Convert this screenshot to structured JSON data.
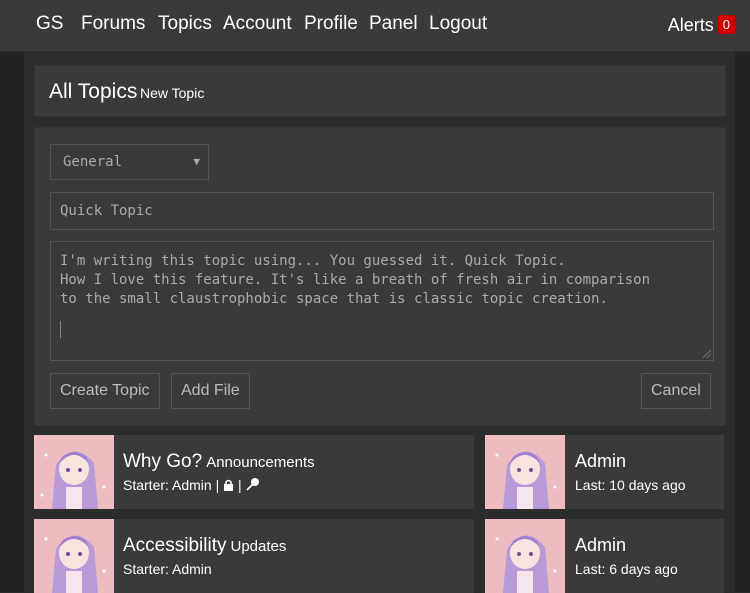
{
  "nav": {
    "brand": "GS",
    "links": [
      "Forums",
      "Topics",
      "Account",
      "Profile",
      "Panel",
      "Logout"
    ],
    "alerts_label": "Alerts",
    "alerts_count": "0"
  },
  "heading": {
    "title": "All Topics",
    "new_topic": "New Topic"
  },
  "quick_topic": {
    "forum_select": "General",
    "title_placeholder": "Quick Topic",
    "content": "I'm writing this topic using... You guessed it. Quick Topic.\nHow I love this feature. It's like a breath of fresh air in comparison\nto the small claustrophobic space that is classic topic creation.",
    "create_button": "Create Topic",
    "add_file_button": "Add File",
    "cancel_button": "Cancel"
  },
  "topics": [
    {
      "title": "Why Go?",
      "forum": "Announcements",
      "starter": "Starter: Admin",
      "flags": [
        "lock-icon",
        "pin-icon"
      ],
      "last_poster": "Admin",
      "last_time": "Last: 10 days ago"
    },
    {
      "title": "Accessibility",
      "forum": "Updates",
      "starter": "Starter: Admin",
      "flags": [],
      "last_poster": "Admin",
      "last_time": "Last: 6 days ago"
    }
  ],
  "colors": {
    "alert_badge": "#d40000",
    "panel": "#3a3a3a",
    "background": "#2a2a2a"
  }
}
